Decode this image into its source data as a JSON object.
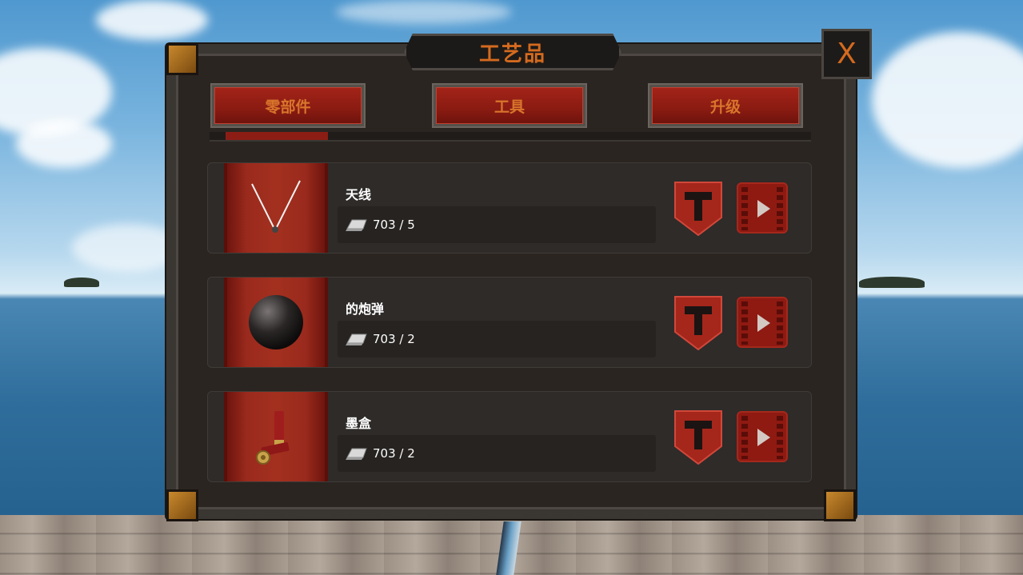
{
  "window": {
    "title": "工艺品",
    "close_label": "X"
  },
  "tabs": [
    {
      "label": "零部件"
    },
    {
      "label": "工具"
    },
    {
      "label": "升级"
    }
  ],
  "items": [
    {
      "name": "天线",
      "cost": "703 / 5",
      "image_icon": "antenna-icon"
    },
    {
      "name": "的炮弹",
      "cost": "703 / 2",
      "image_icon": "cannonball-icon"
    },
    {
      "name": "墨盒",
      "cost": "703 / 2",
      "image_icon": "shotgun-shells-icon"
    }
  ],
  "colors": {
    "accent": "#d46a1f",
    "button_red": "#8e1a12",
    "panel": "#2a2521"
  }
}
